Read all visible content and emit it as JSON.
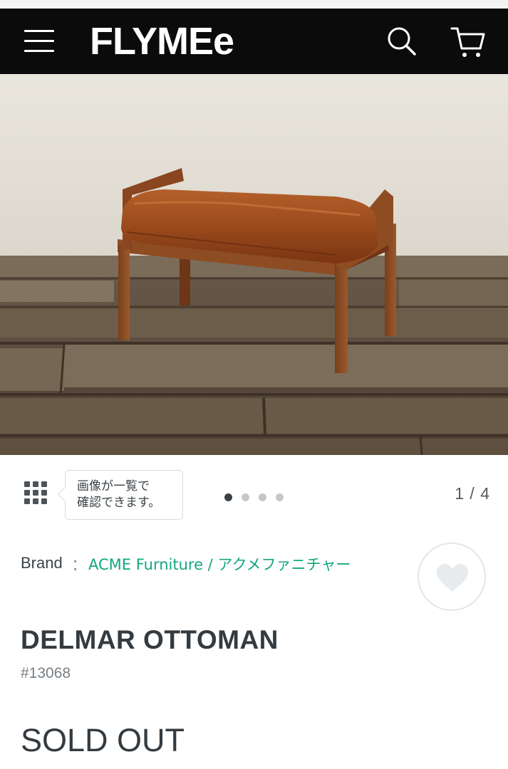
{
  "header": {
    "logo": "FLYMEe",
    "menu_icon": "hamburger-menu-icon",
    "search_icon": "search-icon",
    "cart_icon": "cart-icon"
  },
  "gallery": {
    "image_alt": "DELMAR OTTOMAN",
    "tooltip_line1": "画像が一覧で",
    "tooltip_line2": "確認できます。",
    "current": 1,
    "total": 4,
    "pager": "1 / 4",
    "grid_icon": "grid-icon"
  },
  "product": {
    "brand_label": "Brand",
    "brand_sep": "：",
    "brand_name": "ACME Furniture / アクメファニチャー",
    "favorite_icon": "heart-icon",
    "title": "DELMAR OTTOMAN",
    "code": "#13068",
    "status": "SOLD OUT"
  },
  "colors": {
    "header_bg": "#0b0b0b",
    "brand_link": "#12a77e",
    "text": "#343b40"
  }
}
